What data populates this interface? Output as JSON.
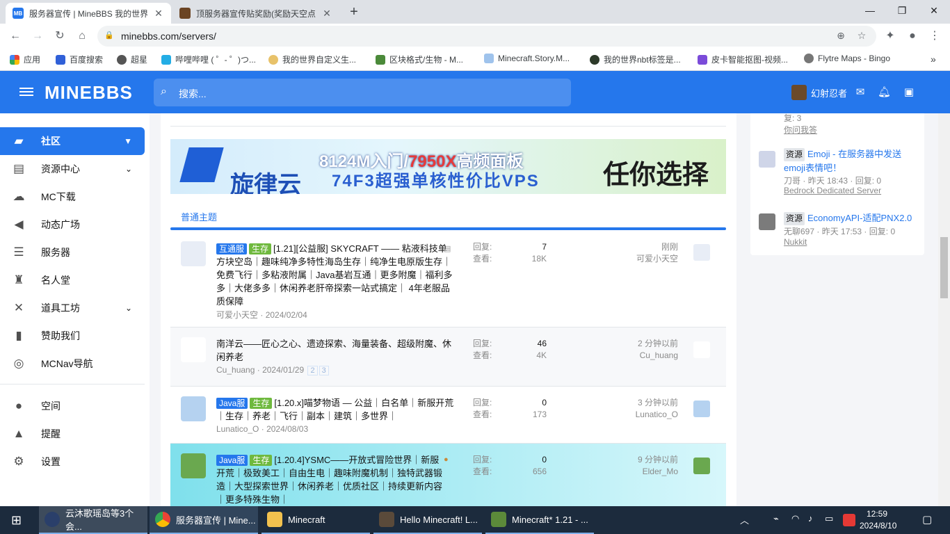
{
  "browser": {
    "tabs": [
      {
        "favicon": "MB",
        "title": "服务器宣传 | MineBBS 我的世界",
        "active": true
      },
      {
        "favicon": "",
        "title": "顶服务器宣传贴奖励(奖励天空点",
        "active": false
      }
    ],
    "url": "minebbs.com/servers/",
    "bookmarks": [
      "应用",
      "百度搜索",
      "超星",
      "哔哩哔哩 ( ゜- ゜)つ...",
      "我的世界自定义生...",
      "区块格式/生物 - M...",
      "Minecraft.Story.M...",
      "我的世界nbt标签是...",
      "皮卡智能抠图-视频...",
      "Flytre Maps - Bingo"
    ]
  },
  "header": {
    "logo": "MINEBBS",
    "search_placeholder": "搜索...",
    "username": "幻射忍者"
  },
  "sidebar": {
    "items": [
      {
        "label": "社区",
        "icon": "chat-icon",
        "active": true,
        "chevron": true
      },
      {
        "label": "资源中心",
        "icon": "resource-icon",
        "chevron": true
      },
      {
        "label": "MC下载",
        "icon": "download-icon"
      },
      {
        "label": "动态广场",
        "icon": "megaphone-icon"
      },
      {
        "label": "服务器",
        "icon": "server-icon"
      },
      {
        "label": "名人堂",
        "icon": "trophy-icon"
      },
      {
        "label": "道具工坊",
        "icon": "tools-icon",
        "chevron": true
      },
      {
        "label": "赞助我们",
        "icon": "battery-icon"
      },
      {
        "label": "MCNav导航",
        "icon": "compass-icon"
      }
    ],
    "user_items": [
      {
        "label": "空间",
        "icon": "user-icon"
      },
      {
        "label": "提醒",
        "icon": "bell-icon"
      },
      {
        "label": "设置",
        "icon": "gear-icon"
      }
    ]
  },
  "banner": {
    "line1_prefix": "8124M入门/",
    "line1_highlight": "7950X",
    "line1_suffix": "高频面板",
    "line2": "74F3超强单核性价比VPS",
    "brand": "旋律云",
    "slogan": "任你选择"
  },
  "section_title": "普通主题",
  "threads": [
    {
      "badges": [
        {
          "text": "互通服",
          "color": "blue"
        },
        {
          "text": "生存",
          "color": "green"
        }
      ],
      "title": "[1.21][公益服] SKYCRAFT —— 粘液科技单方块空岛｜趣味纯净多特性海岛生存｜纯净生电原版生存｜免费飞行｜多粘液附属｜Java基岩互通｜更多附魔｜福利多多｜大佬多多｜休闲养老肝帝探索一站式搞定｜ 4年老服品质保障",
      "author": "可爱小天空",
      "date": "2024/02/04",
      "pages": [],
      "replies_label": "回复:",
      "replies": "7",
      "views_label": "查看:",
      "views": "18K",
      "last_time": "刚刚",
      "last_user": "可爱小天空"
    },
    {
      "badges": [],
      "title": "南洋云——匠心之心、遗迹探索、海量装备、超级附魔、休闲养老",
      "author": "Cu_huang",
      "date": "2024/01/29",
      "pages": [
        "2",
        "3"
      ],
      "replies_label": "回复:",
      "replies": "46",
      "views_label": "查看:",
      "views": "4K",
      "last_time": "2 分钟以前",
      "last_user": "Cu_huang"
    },
    {
      "badges": [
        {
          "text": "Java服",
          "color": "blue"
        },
        {
          "text": "生存",
          "color": "green"
        }
      ],
      "title": "[1.20.x]喵梦物语 — 公益｜白名单｜新服开荒｜生存｜养老｜飞行｜副本｜建筑｜多世界｜",
      "author": "Lunatico_O",
      "date": "2024/08/03",
      "pages": [],
      "replies_label": "回复:",
      "replies": "0",
      "views_label": "查看:",
      "views": "173",
      "last_time": "3 分钟以前",
      "last_user": "Lunatico_O"
    },
    {
      "badges": [
        {
          "text": "Java服",
          "color": "blue"
        },
        {
          "text": "生存",
          "color": "green"
        }
      ],
      "title": "[1.20.4]YSMC——开放式冒险世界｜新服开荒｜极致美工｜自由生电｜趣味附魔机制｜独特武器锻造｜大型探索世界｜休闲养老｜优质社区｜持续更新内容｜更多特殊生物｜",
      "author": "",
      "date": "",
      "pages": [],
      "replies_label": "回复:",
      "replies": "0",
      "views_label": "查看:",
      "views": "656",
      "last_time": "9 分钟以前",
      "last_user": "Elder_Mo"
    }
  ],
  "right_panel": {
    "top_meta": "复: 3",
    "top_link": "你问我答",
    "items": [
      {
        "tag": "资源",
        "title": "Emoji - 在服务器中发送emoji表情吧！",
        "author": "刀哥",
        "time": "昨天 18:43",
        "replies_label": "回复:",
        "replies": "0",
        "forum": "Bedrock Dedicated Server"
      },
      {
        "tag": "资源",
        "title": "EconomyAPI-适配PNX2.0",
        "author": "无聊697",
        "time": "昨天 17:53",
        "replies_label": "回复:",
        "replies": "0",
        "forum": "Nukkit"
      }
    ]
  },
  "taskbar": {
    "items": [
      "云沐歌瑶岛等3个会...",
      "服务器宣传 | Mine...",
      "Minecraft",
      "Hello Minecraft! L...",
      "Minecraft* 1.21 - ..."
    ],
    "time": "12:59",
    "date": "2024/8/10"
  }
}
